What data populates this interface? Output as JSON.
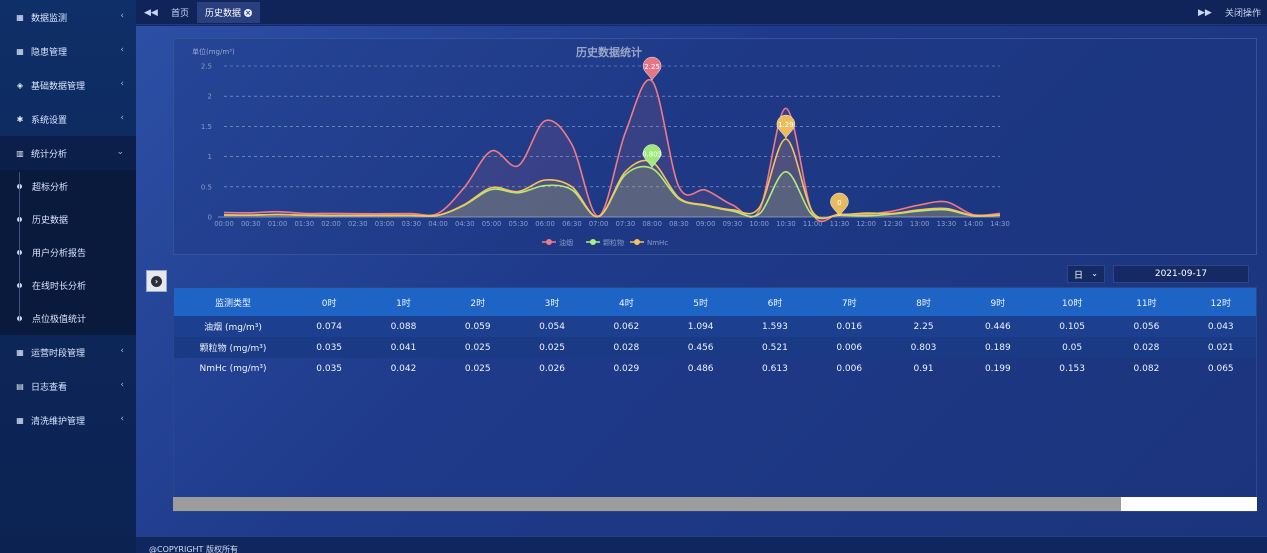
{
  "sidebar": {
    "items": [
      {
        "label": "数据监测",
        "icon": "calendar-icon"
      },
      {
        "label": "隐患管理",
        "icon": "calendar-icon"
      },
      {
        "label": "基础数据管理",
        "icon": "layers-icon"
      },
      {
        "label": "系统设置",
        "icon": "gear-icon"
      },
      {
        "label": "统计分析",
        "icon": "bar-chart-icon",
        "expanded": true,
        "children": [
          "超标分析",
          "历史数据",
          "用户分析报告",
          "在线时长分析",
          "点位极值统计"
        ]
      },
      {
        "label": "运营时段管理",
        "icon": "calendar-icon"
      },
      {
        "label": "日志查看",
        "icon": "log-icon"
      },
      {
        "label": "清洗维护管理",
        "icon": "calendar-icon"
      }
    ]
  },
  "tabbar": {
    "home": "首页",
    "active_tab": "历史数据",
    "close_ops": "关闭操作"
  },
  "chart_data": {
    "type": "line",
    "title": "历史数据统计",
    "ylabel": "单位(mg/m³)",
    "ylim": [
      0,
      2.5
    ],
    "yticks": [
      "0",
      "0.5",
      "1",
      "1.5",
      "2",
      "2.5"
    ],
    "x": [
      "00:00",
      "00:30",
      "01:00",
      "01:30",
      "02:00",
      "02:30",
      "03:00",
      "03:30",
      "04:00",
      "04:30",
      "05:00",
      "05:30",
      "06:00",
      "06:30",
      "07:00",
      "07:30",
      "08:00",
      "08:30",
      "09:00",
      "09:30",
      "10:00",
      "10:30",
      "11:00",
      "11:30",
      "12:00",
      "12:30",
      "13:00",
      "13:30",
      "14:00",
      "14:30"
    ],
    "series": [
      {
        "name": "油烟",
        "color": "#f07a86",
        "values": [
          0.074,
          0.07,
          0.088,
          0.06,
          0.059,
          0.055,
          0.054,
          0.058,
          0.062,
          0.5,
          1.094,
          0.85,
          1.593,
          1.2,
          0.016,
          1.4,
          2.25,
          0.5,
          0.446,
          0.2,
          0.105,
          1.8,
          0.056,
          0.05,
          0.043,
          0.1,
          0.2,
          0.25,
          0.04,
          0.06
        ]
      },
      {
        "name": "颗粒物",
        "color": "#a6f27e",
        "values": [
          0.035,
          0.03,
          0.041,
          0.03,
          0.025,
          0.025,
          0.025,
          0.026,
          0.028,
          0.2,
          0.456,
          0.4,
          0.521,
          0.45,
          0.006,
          0.7,
          0.803,
          0.3,
          0.189,
          0.1,
          0.05,
          0.75,
          0.028,
          0.03,
          0.021,
          0.05,
          0.1,
          0.12,
          0.02,
          0.03
        ]
      },
      {
        "name": "NmHc",
        "color": "#f3c35c",
        "values": [
          0.035,
          0.03,
          0.042,
          0.03,
          0.025,
          0.025,
          0.026,
          0.028,
          0.029,
          0.21,
          0.486,
          0.42,
          0.613,
          0.5,
          0.006,
          0.75,
          0.91,
          0.32,
          0.199,
          0.12,
          0.153,
          1.29,
          0.082,
          0.04,
          0.065,
          0.06,
          0.12,
          0.14,
          0.025,
          0.035
        ]
      }
    ],
    "markers": [
      {
        "label": "2.25",
        "color": "#f07a86",
        "x_index": 16,
        "value": 2.25
      },
      {
        "label": "0.803",
        "color": "#a6f27e",
        "x_index": 16,
        "value": 0.803
      },
      {
        "label": "1.29",
        "color": "#f3c35c",
        "x_index": 21,
        "value": 1.29
      },
      {
        "label": "0",
        "color": "#f3c35c",
        "x_index": 23,
        "value": 0
      }
    ],
    "legend_position": "bottom-center",
    "grid": true
  },
  "controls": {
    "period": "日",
    "date": "2021-09-17"
  },
  "table": {
    "headers": [
      "监测类型",
      "0时",
      "1时",
      "2时",
      "3时",
      "4时",
      "5时",
      "6时",
      "7时",
      "8时",
      "9时",
      "10时",
      "11时",
      "12时"
    ],
    "rows": [
      [
        "油烟 (mg/m³)",
        "0.074",
        "0.088",
        "0.059",
        "0.054",
        "0.062",
        "1.094",
        "1.593",
        "0.016",
        "2.25",
        "0.446",
        "0.105",
        "0.056",
        "0.043"
      ],
      [
        "颗粒物 (mg/m³)",
        "0.035",
        "0.041",
        "0.025",
        "0.025",
        "0.028",
        "0.456",
        "0.521",
        "0.006",
        "0.803",
        "0.189",
        "0.05",
        "0.028",
        "0.021"
      ],
      [
        "NmHc (mg/m³)",
        "0.035",
        "0.042",
        "0.025",
        "0.026",
        "0.029",
        "0.486",
        "0.613",
        "0.006",
        "0.91",
        "0.199",
        "0.153",
        "0.082",
        "0.065"
      ]
    ]
  },
  "footer": "@COPYRIGHT 版权所有"
}
